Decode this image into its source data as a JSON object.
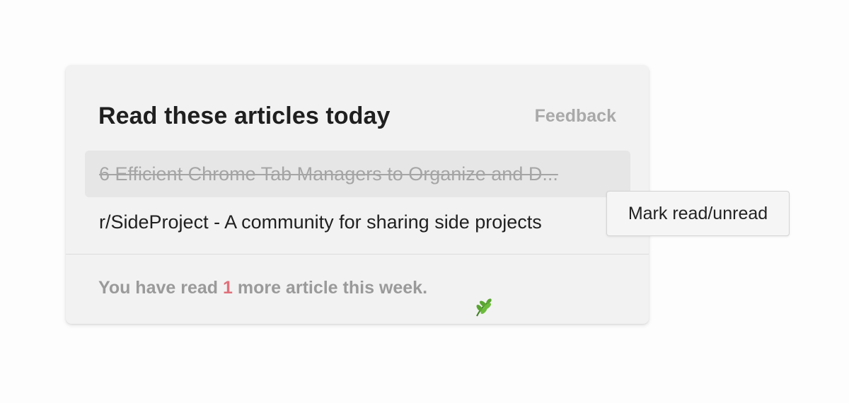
{
  "card": {
    "title": "Read these articles today",
    "feedback_label": "Feedback"
  },
  "articles": [
    {
      "title": "6 Efficient Chrome Tab Managers to Organize and D...",
      "status": "read"
    },
    {
      "title": "r/SideProject - A community for sharing side projects",
      "status": "unread"
    }
  ],
  "footer": {
    "prefix": "You have read ",
    "count": "1",
    "suffix": " more article this week.",
    "icon": "leaf-icon"
  },
  "context_menu": {
    "item_label": "Mark read/unread"
  },
  "colors": {
    "card_background": "#f2f2f2",
    "read_row_background": "#e6e6e6",
    "count_accent": "#e0707a",
    "leaf_green": "#5aa532"
  }
}
